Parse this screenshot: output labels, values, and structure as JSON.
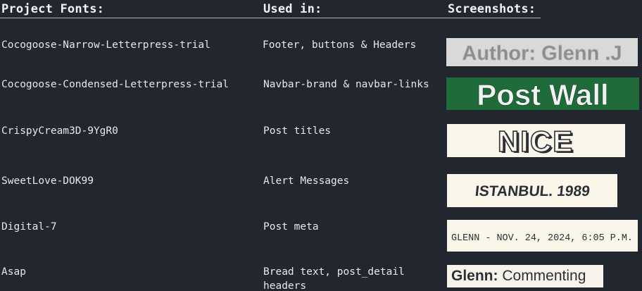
{
  "headers": {
    "fonts": "Project Fonts:",
    "used_in": "Used in:",
    "screenshots": "Screenshots:"
  },
  "rows": [
    {
      "font": "Cocogoose-Narrow-Letterpress-trial",
      "used_in": "Footer, buttons & Headers",
      "sample_text": "Author: Glenn .J",
      "sample_bg": "#d9d9d9",
      "sample_color": "#8a8a8a"
    },
    {
      "font": "Cocogoose-Condensed-Letterpress-trial",
      "used_in": "Navbar-brand & navbar-links",
      "sample_text": "Post Wall",
      "sample_bg": "#1f6b3a",
      "sample_color": "#f2f2f2"
    },
    {
      "font": "CrispyCream3D-9YgR0",
      "used_in": "Post titles",
      "sample_text": "NICE",
      "sample_bg": "#fbf6ea",
      "sample_color": "#2b2f36"
    },
    {
      "font": "SweetLove-DOK99",
      "used_in": "Alert Messages",
      "sample_text": "ISTANBUL. 1989",
      "sample_bg": "#fbf6ea",
      "sample_color": "#2b2f36"
    },
    {
      "font": "Digital-7",
      "used_in": "Post meta",
      "sample_text": "GLENN - NOV. 24, 2024, 6:05 P.M.",
      "sample_bg": "#fbf6ea",
      "sample_color": "#2b2f36"
    },
    {
      "font": "Asap",
      "used_in": "Bread text, post_detail headers",
      "sample_bold": "Glenn:",
      "sample_text": "Commenting",
      "sample_bg": "#f7f3ea",
      "sample_color": "#2b2f36"
    }
  ]
}
